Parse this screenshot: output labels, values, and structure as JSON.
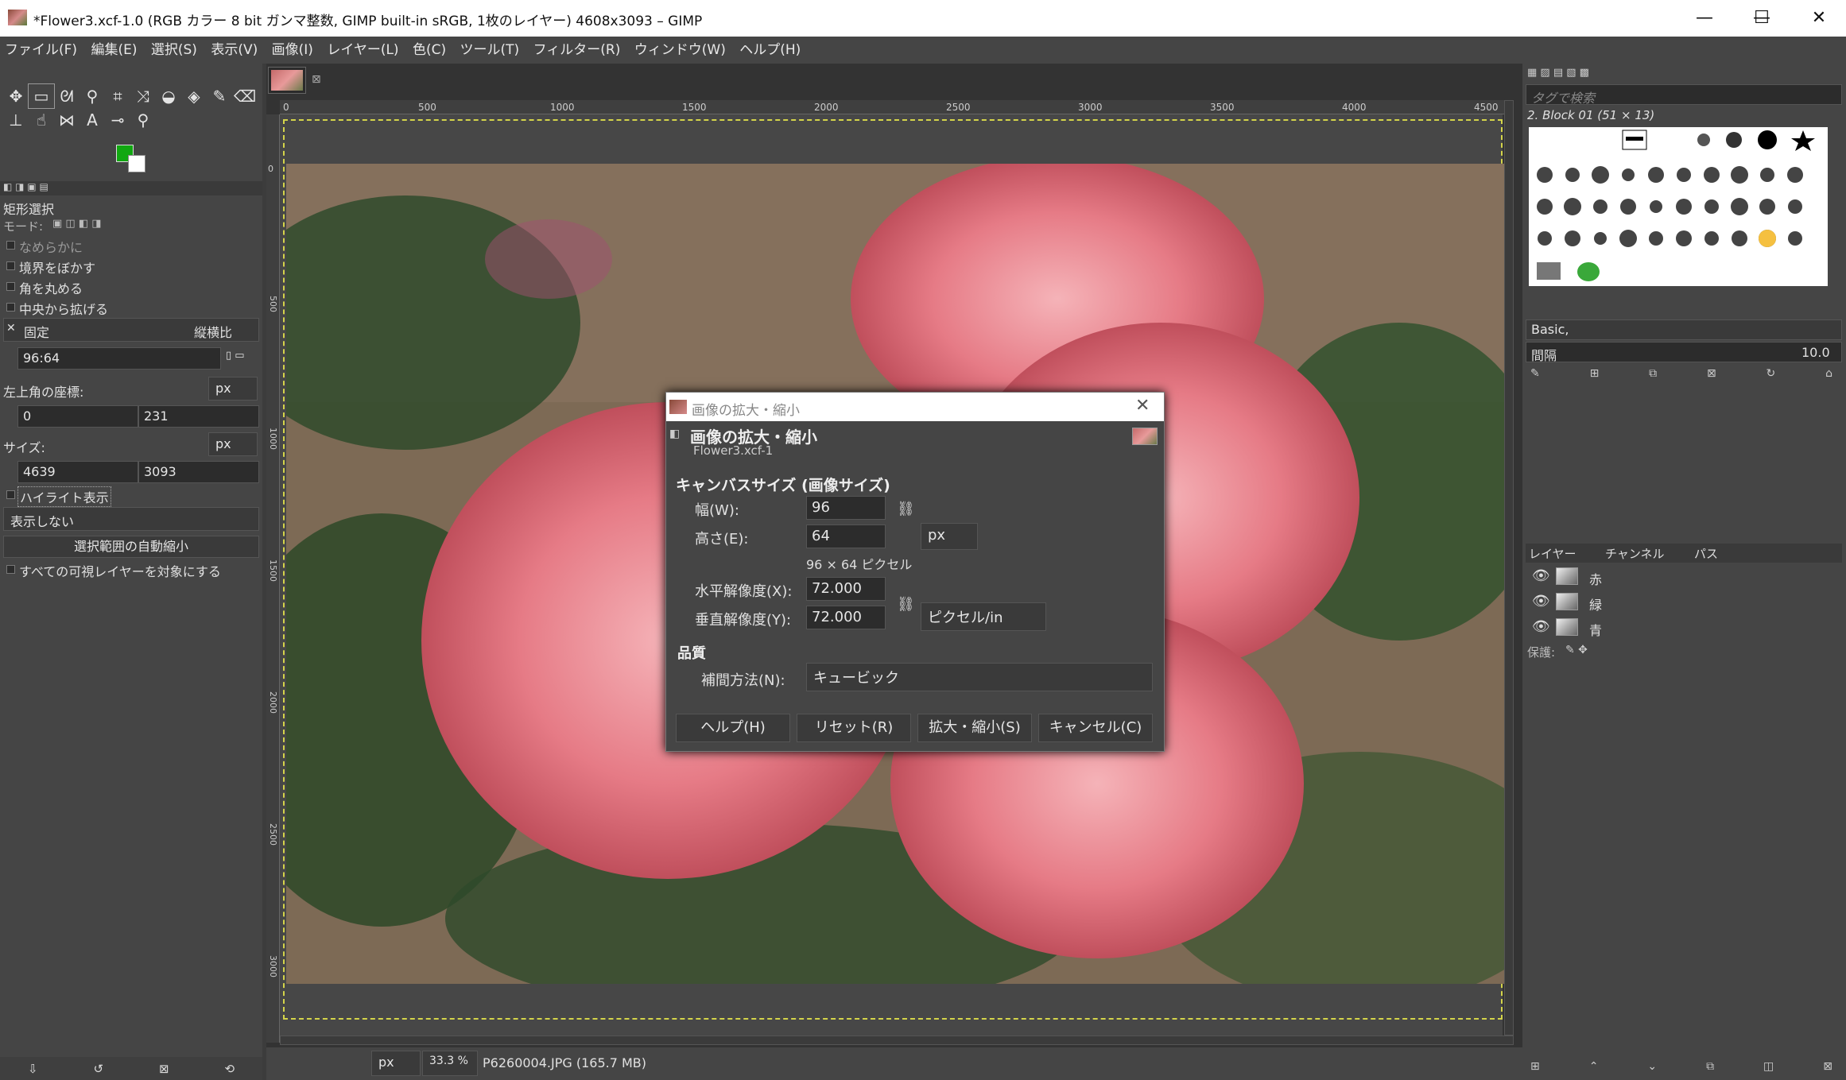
{
  "window": {
    "title": "*Flower3.xcf-1.0 (RGB カラー 8 bit ガンマ整数, GIMP built-in sRGB, 1枚のレイヤー) 4608x3093 – GIMP",
    "minimize": "—",
    "maximize": "☐",
    "close": "✕"
  },
  "menu": [
    "ファイル(F)",
    "編集(E)",
    "選択(S)",
    "表示(V)",
    "画像(I)",
    "レイヤー(L)",
    "色(C)",
    "ツール(T)",
    "フィルター(R)",
    "ウィンドウ(W)",
    "ヘルプ(H)"
  ],
  "tool_options": {
    "title": "矩形選択",
    "mode_label": "モード:",
    "antialias": "なめらかに",
    "feather": "境界をぼかす",
    "rounded": "角を丸める",
    "expand_center": "中央から拡げる",
    "fixed": "固定",
    "fixed_mode": "縦横比",
    "ratio_value": "96:64",
    "position_label": "左上角の座標:",
    "position_unit": "px",
    "pos_x": "0",
    "pos_y": "231",
    "size_label": "サイズ:",
    "size_unit": "px",
    "size_w": "4639",
    "size_h": "3093",
    "highlight": "ハイライト表示",
    "guides": "表示しない",
    "autoshrink": "選択範囲の自動縮小",
    "all_layers": "すべての可視レイヤーを対象にする"
  },
  "ruler": {
    "h_ticks": [
      "0",
      "500",
      "1000",
      "1500",
      "2000",
      "2500",
      "3000",
      "3500",
      "4000",
      "4500"
    ],
    "v_ticks": [
      "0",
      "500",
      "1000",
      "1500",
      "2000",
      "2500",
      "3000"
    ]
  },
  "dialog": {
    "window_title": "画像の拡大・縮小",
    "heading": "画像の拡大・縮小",
    "subheading": "Flower3.xcf-1",
    "canvas_size_label": "キャンバスサイズ (画像サイズ)",
    "width_label": "幅(W):",
    "width_value": "96",
    "height_label": "高さ(E):",
    "height_value": "64",
    "size_unit": "px",
    "pixels_note": "96 × 64 ピクセル",
    "xres_label": "水平解像度(X):",
    "xres_value": "72.000",
    "yres_label": "垂直解像度(Y):",
    "yres_value": "72.000",
    "res_unit": "ピクセル/in",
    "quality_label": "品質",
    "interp_label": "補間方法(N):",
    "interp_value": "キュービック",
    "help_btn": "ヘルプ(H)",
    "reset_btn": "リセット(R)",
    "scale_btn": "拡大・縮小(S)",
    "cancel_btn": "キャンセル(C)"
  },
  "status": {
    "unit": "px",
    "zoom": "33.3 %",
    "file": "P6260004.JPG (165.7 MB)"
  },
  "brushes": {
    "search_placeholder": "タグで検索",
    "selected": "2. Block 01 (51 × 13)",
    "preset": "Basic,",
    "spacing_label": "間隔",
    "spacing_value": "10.0"
  },
  "layers": {
    "tabs": [
      "レイヤー",
      "チャンネル",
      "パス"
    ],
    "items": [
      "赤",
      "緑",
      "青"
    ],
    "lock_label": "保護:"
  },
  "colors": {
    "fg": "#11a811",
    "bg": "#ffffff"
  }
}
